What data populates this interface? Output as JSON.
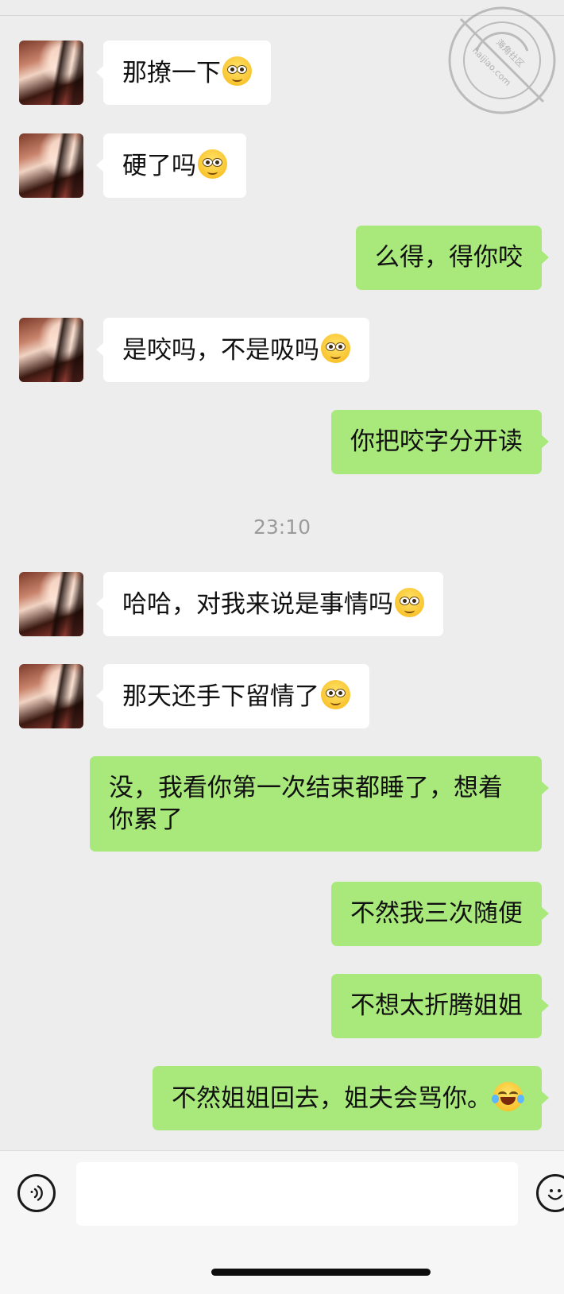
{
  "watermark": {
    "name": "海角社区",
    "domain": "haijiao.com"
  },
  "messages": [
    {
      "side": "left",
      "text": "那撩一下",
      "emoji": "smirk"
    },
    {
      "side": "left",
      "text": "硬了吗",
      "emoji": "smirk"
    },
    {
      "side": "right",
      "text": "么得，得你咬"
    },
    {
      "side": "left",
      "text": "是咬吗，不是吸吗",
      "emoji": "smirk"
    },
    {
      "side": "right",
      "text": "你把咬字分开读"
    },
    {
      "timestamp": "23:10"
    },
    {
      "side": "left",
      "text": "哈哈，对我来说是事情吗",
      "emoji": "smirk"
    },
    {
      "side": "left",
      "text": "那天还手下留情了",
      "emoji": "smirk"
    },
    {
      "side": "right",
      "text": "没，我看你第一次结束都睡了，想着你累了"
    },
    {
      "side": "right",
      "text": "不然我三次随便"
    },
    {
      "side": "right",
      "text": "不想太折腾姐姐"
    },
    {
      "side": "right",
      "text": "不然姐姐回去，姐夫会骂你。",
      "emoji": "tears-of-joy"
    }
  ],
  "input": {
    "value": "",
    "placeholder": ""
  },
  "icons": {
    "voice": "voice-icon",
    "emoji": "emoji-icon"
  },
  "colors": {
    "sent_bubble": "#a9e97c",
    "received_bubble": "#ffffff",
    "background": "#ededed"
  }
}
